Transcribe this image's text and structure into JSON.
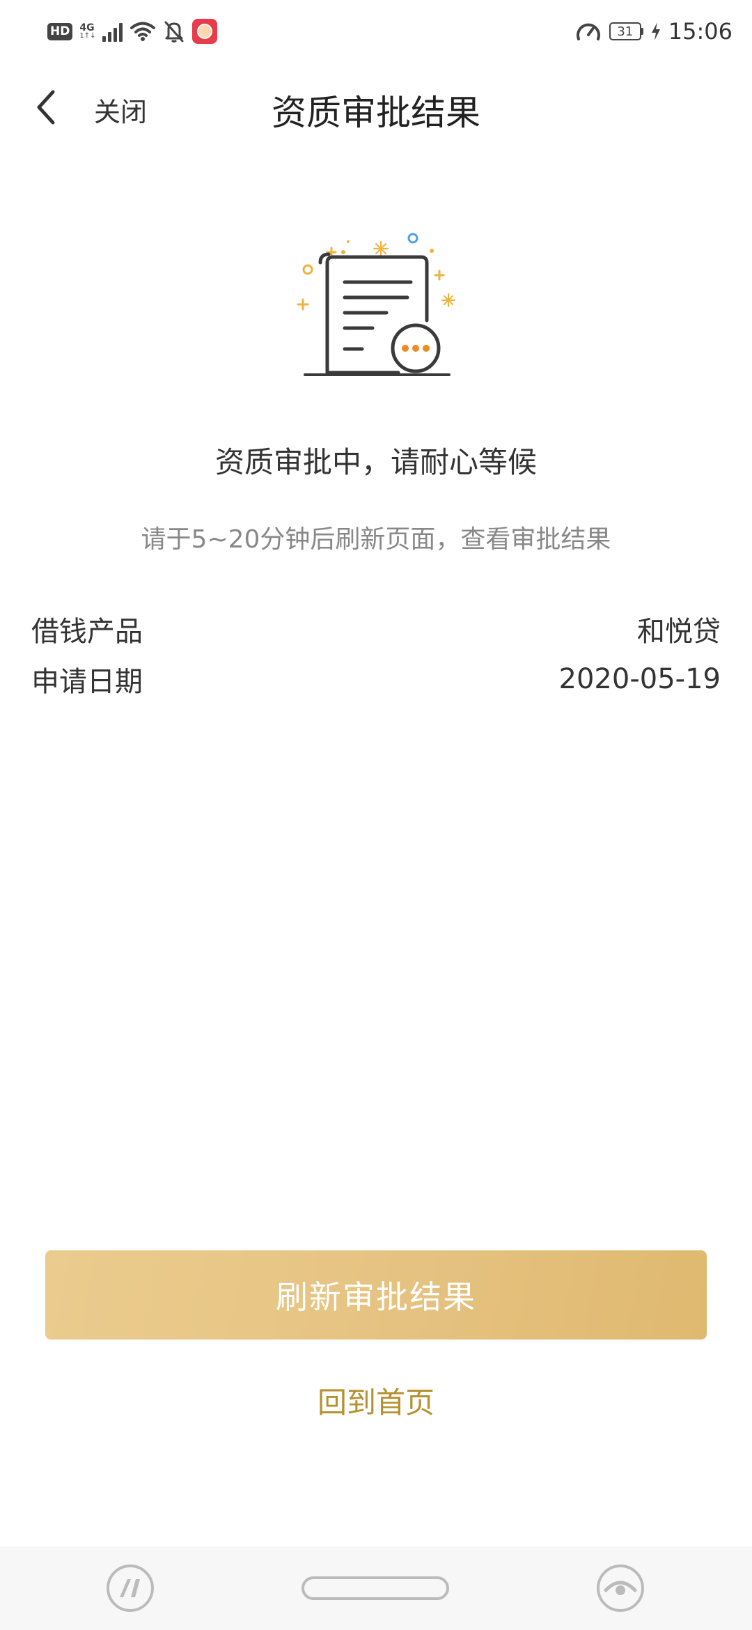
{
  "status_bar": {
    "hd": "HD",
    "network": "4G",
    "network_sub": "1↑↓",
    "battery": "31",
    "time": "15:06"
  },
  "header": {
    "close_label": "关闭",
    "title": "资质审批结果"
  },
  "status": {
    "heading": "资质审批中，请耐心等候",
    "hint": "请于5~20分钟后刷新页面，查看审批结果"
  },
  "info": [
    {
      "label": "借钱产品",
      "value": "和悦贷"
    },
    {
      "label": "申请日期",
      "value": "2020-05-19"
    }
  ],
  "actions": {
    "refresh_label": "刷新审批结果",
    "home_label": "回到首页"
  },
  "colors": {
    "accent_gold": "#e5c17f",
    "link_gold": "#b6912f",
    "illustration_orange": "#f08a24"
  },
  "icons": [
    "back-chevron-icon",
    "document-pending-icon",
    "wifi-icon",
    "bell-muted-icon",
    "speed-gauge-icon",
    "charging-icon"
  ]
}
